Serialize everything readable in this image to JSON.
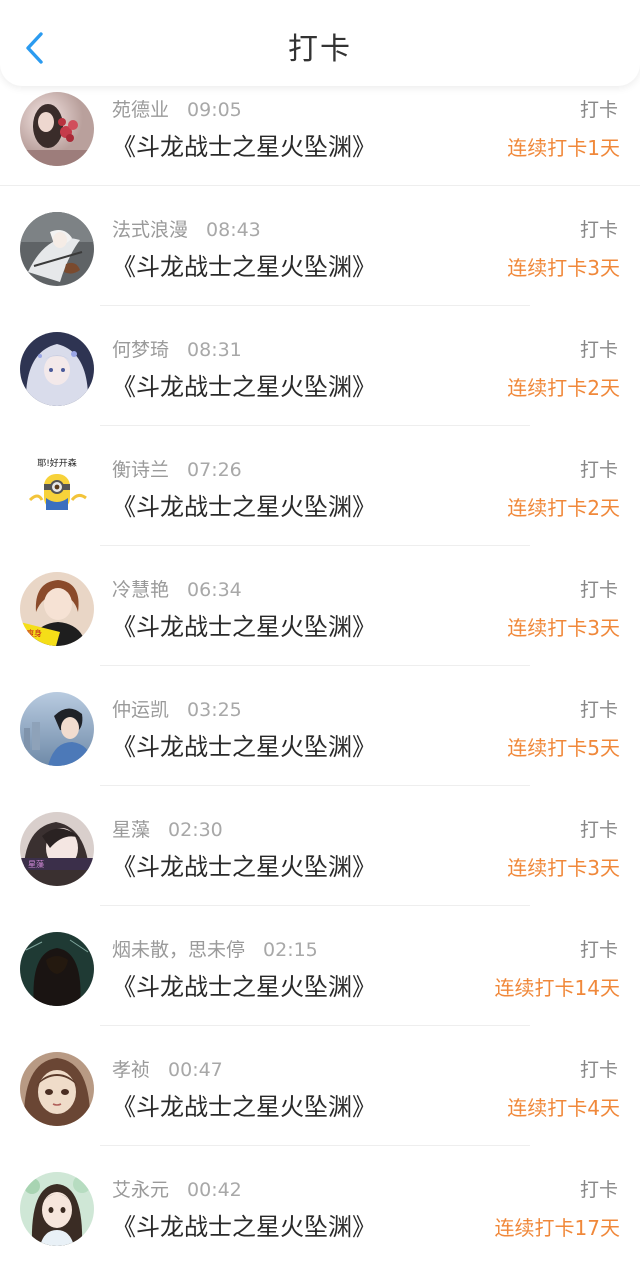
{
  "header": {
    "title": "打卡",
    "back_icon": "chevron-left-icon",
    "accent_color": "#2b9bf0"
  },
  "streak_color": "#f0883a",
  "entries": [
    {
      "user": "苑德业",
      "time": "09:05",
      "action": "打卡",
      "book": "《斗龙战士之星火坠渊》",
      "streak": "连续打卡1天"
    },
    {
      "user": "法式浪漫",
      "time": "08:43",
      "action": "打卡",
      "book": "《斗龙战士之星火坠渊》",
      "streak": "连续打卡3天"
    },
    {
      "user": "何梦琦",
      "time": "08:31",
      "action": "打卡",
      "book": "《斗龙战士之星火坠渊》",
      "streak": "连续打卡2天"
    },
    {
      "user": "衡诗兰",
      "time": "07:26",
      "action": "打卡",
      "book": "《斗龙战士之星火坠渊》",
      "streak": "连续打卡2天",
      "avatar_caption": "耶!好开森"
    },
    {
      "user": "冷慧艳",
      "time": "06:34",
      "action": "打卡",
      "book": "《斗龙战士之星火坠渊》",
      "streak": "连续打卡3天"
    },
    {
      "user": "仲运凯",
      "time": "03:25",
      "action": "打卡",
      "book": "《斗龙战士之星火坠渊》",
      "streak": "连续打卡5天"
    },
    {
      "user": "星藻",
      "time": "02:30",
      "action": "打卡",
      "book": "《斗龙战士之星火坠渊》",
      "streak": "连续打卡3天"
    },
    {
      "user": "烟未散，思未停",
      "time": "02:15",
      "action": "打卡",
      "book": "《斗龙战士之星火坠渊》",
      "streak": "连续打卡14天"
    },
    {
      "user": "孝祯",
      "time": "00:47",
      "action": "打卡",
      "book": "《斗龙战士之星火坠渊》",
      "streak": "连续打卡4天"
    },
    {
      "user": "艾永元",
      "time": "00:42",
      "action": "打卡",
      "book": "《斗龙战士之星火坠渊》",
      "streak": "连续打卡17天"
    }
  ]
}
